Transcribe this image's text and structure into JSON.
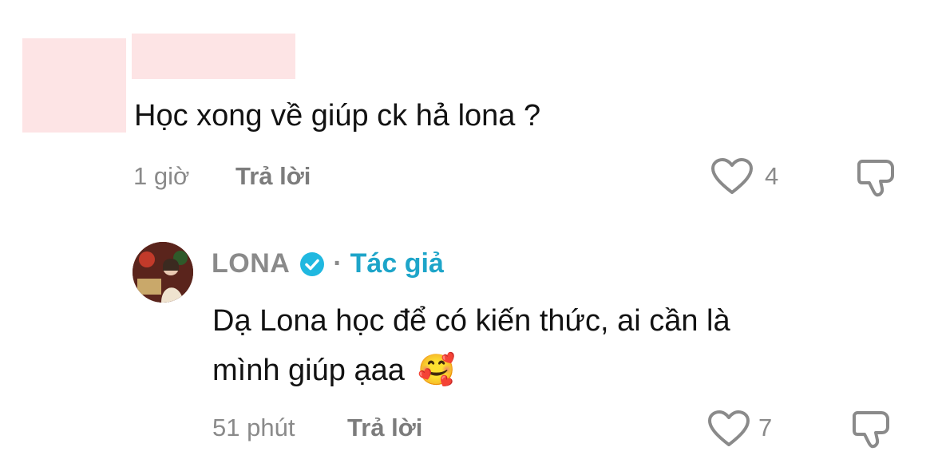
{
  "comments": [
    {
      "text": "Học xong về giúp ck hả lona ?",
      "time": "1 giờ",
      "reply_label": "Trả lời",
      "like_count": "4",
      "icons": {
        "like": "heart-outline-icon",
        "dislike": "thumbs-down-outline-icon"
      }
    }
  ],
  "reply": {
    "author": "LONA",
    "separator": "·",
    "author_tag": "Tác giả",
    "text_line1": "Dạ Lona học để có kiến thức, ai cần là",
    "text_line2": "mình giúp ạaa",
    "emoji": "🥰",
    "time": "51 phút",
    "reply_label": "Trả lời",
    "like_count": "7",
    "icons": {
      "verified": "verified-check-icon",
      "like": "heart-outline-icon",
      "dislike": "thumbs-down-outline-icon"
    }
  },
  "colors": {
    "redaction": "#fde4e5",
    "muted_text": "#8a8a8a",
    "author_tag": "#1ea5c9",
    "verified_badge": "#20b8e0"
  }
}
